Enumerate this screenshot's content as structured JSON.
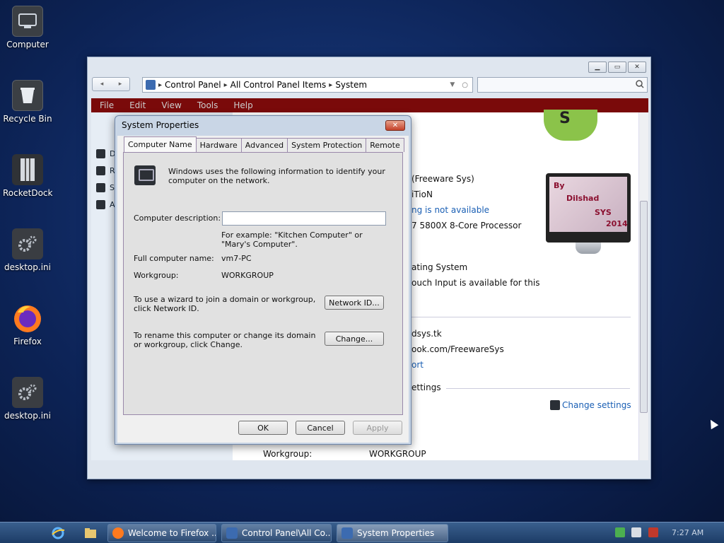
{
  "desktop": {
    "icons": [
      {
        "label": "Computer",
        "icon": "computer-icon"
      },
      {
        "label": "Recycle Bin",
        "icon": "recycle-bin-icon"
      },
      {
        "label": "RocketDock",
        "icon": "rocketdock-icon"
      },
      {
        "label": "desktop.ini",
        "icon": "settings-file-icon"
      },
      {
        "label": "Firefox",
        "icon": "firefox-icon"
      },
      {
        "label": "desktop.ini",
        "icon": "settings-file-icon"
      }
    ]
  },
  "control_panel": {
    "breadcrumb": [
      "Control Panel",
      "All Control Panel Items",
      "System"
    ],
    "menu": [
      "File",
      "Edit",
      "View",
      "Tools",
      "Help"
    ],
    "left_items": [
      "D",
      "R",
      "S",
      "A"
    ],
    "main_lines": {
      "manufacturer": "(Freeware Sys)",
      "edition": "iTioN",
      "rating": "ng is not available",
      "processor": "7 5800X 8-Core Processor",
      "system_type": "ating System",
      "pen_touch": "ouch Input is available for this",
      "website": "dsys.tk",
      "facebook": "ook.com/FreewareSys",
      "support": "ort",
      "settings_header": "ettings",
      "change_settings": "Change settings",
      "workgroup_label": "Workgroup:",
      "workgroup_value": "WORKGROUP"
    },
    "oem_logo_text": [
      "By",
      "Dilshad",
      "SYS",
      "2014"
    ],
    "android_logo_text": "S"
  },
  "dialog": {
    "title": "System Properties",
    "tabs": [
      "Computer Name",
      "Hardware",
      "Advanced",
      "System Protection",
      "Remote"
    ],
    "active_tab": "Computer Name",
    "intro": "Windows uses the following information to identify your computer on the network.",
    "description_label": "Computer description:",
    "description_value": "",
    "example": "For example: \"Kitchen Computer\" or \"Mary's Computer\".",
    "full_name_label": "Full computer name:",
    "full_name_value": "vm7-PC",
    "workgroup_label": "Workgroup:",
    "workgroup_value": "WORKGROUP",
    "wizard_text": "To use a wizard to join a domain or workgroup, click Network ID.",
    "network_id_button": "Network ID...",
    "rename_text": "To rename this computer or change its domain or workgroup, click Change.",
    "change_button": "Change...",
    "ok_button": "OK",
    "cancel_button": "Cancel",
    "apply_button": "Apply"
  },
  "taskbar": {
    "buttons": [
      {
        "label": "Welcome to Firefox ...",
        "icon": "firefox-icon"
      },
      {
        "label": "Control Panel\\All Co...",
        "icon": "control-panel-icon"
      },
      {
        "label": "System Properties",
        "icon": "system-properties-icon"
      }
    ],
    "clock": "7:27 AM"
  }
}
